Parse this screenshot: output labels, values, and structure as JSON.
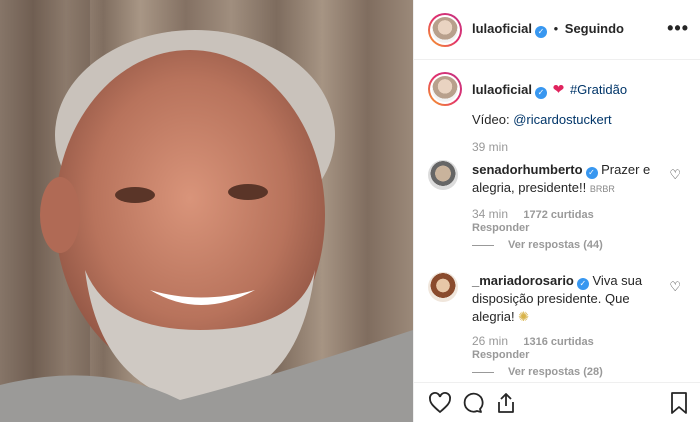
{
  "media": {
    "alt": "video frame"
  },
  "header": {
    "username": "lulaoficial",
    "separator": "•",
    "follow_state": "Seguindo",
    "more": "•••"
  },
  "caption": {
    "username": "lulaoficial",
    "hashtag": "#Gratidão",
    "line2_prefix": "Vídeo: ",
    "mention": "@ricardostuckert",
    "time": "39 min"
  },
  "comments": [
    {
      "username": "senadorhumberto",
      "text": "Prazer e alegria, presidente!!",
      "emoji_text": "BRBR",
      "time": "34 min",
      "likes": "1772 curtidas",
      "reply": "Responder",
      "view_replies": "Ver respostas (44)"
    },
    {
      "username": "_mariadorosario",
      "text": "Viva sua disposição presidente. Que alegria!",
      "emoji_text": "",
      "time": "26 min",
      "likes": "1316 curtidas",
      "reply": "Responder",
      "view_replies": "Ver respostas (28)"
    }
  ],
  "icons": [
    "heart-icon",
    "comment-icon",
    "share-icon",
    "bookmark-icon"
  ]
}
